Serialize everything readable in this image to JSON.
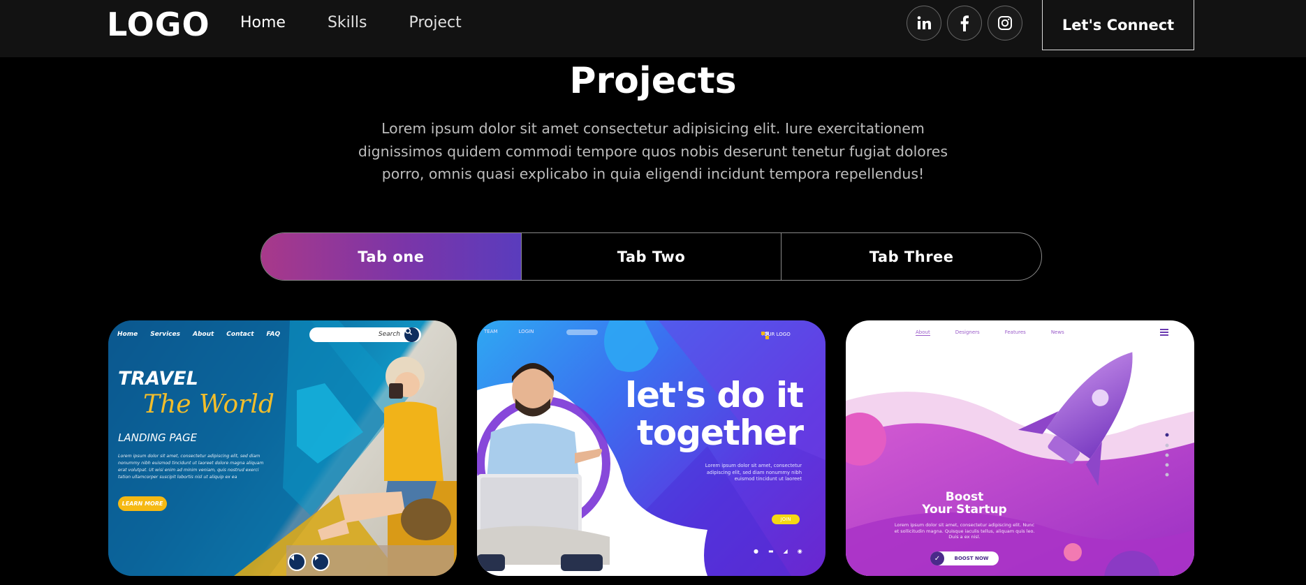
{
  "nav": {
    "logo": "LOGO",
    "links": [
      "Home",
      "Skills",
      "Project"
    ],
    "socials": [
      "linkedin-icon",
      "facebook-icon",
      "instagram-icon"
    ],
    "connect_label": "Let's Connect"
  },
  "section": {
    "title": "Projects",
    "description": "Lorem ipsum dolor sit amet consectetur adipisicing elit. Iure exercitationem dignissimos quidem commodi tempore quos nobis deserunt tenetur fugiat dolores porro, omnis quasi explicabo in quia eligendi incidunt tempora repellendus!"
  },
  "tabs": [
    "Tab one",
    "Tab Two",
    "Tab Three"
  ],
  "cards": [
    {
      "nav": [
        "Home",
        "Services",
        "About",
        "Contact",
        "FAQ"
      ],
      "search": "Search",
      "headline1": "TRAVEL",
      "headline2": "The World",
      "subtitle": "LANDING PAGE",
      "body": "Lorem ipsum dolor sit amet, consectetur adipiscing elit, sed diam nonummy nibh euismod tincidunt ut laoreet dolore magna aliquam erat volutpat. Ut wisi enim ad minim veniam, quis nostrud exerci tation ullamcorper suscipit lobortis nisl ut aliquip ex ea",
      "cta": "LEARN MORE"
    },
    {
      "nav": [
        "TEAM",
        "LOGIN"
      ],
      "brand": "YOUR LOGO",
      "headline1": "let's do it",
      "headline2": "together",
      "body": "Lorem ipsum dolor sit amet, consectetur adipiscing elit, sed diam nonummy nibh euismod tincidunt ut laoreet",
      "cta": "JOIN"
    },
    {
      "nav": [
        "About",
        "Designers",
        "Features",
        "News"
      ],
      "headline1": "Boost",
      "headline2": "Your Startup",
      "body": "Lorem ipsum dolor sit amet, consectetur adipiscing elit. Nunc et sollicitudin magna. Quisque iaculis tellus, aliquam quis leo. Duis a ex nisl.",
      "cta": "BOOST NOW"
    }
  ],
  "colors": {
    "nav_bg": "#121212",
    "page_bg": "#000000",
    "tab_active_start": "#a8398a",
    "tab_active_end": "#5a3cbd",
    "accent_yellow": "#f5b914"
  }
}
